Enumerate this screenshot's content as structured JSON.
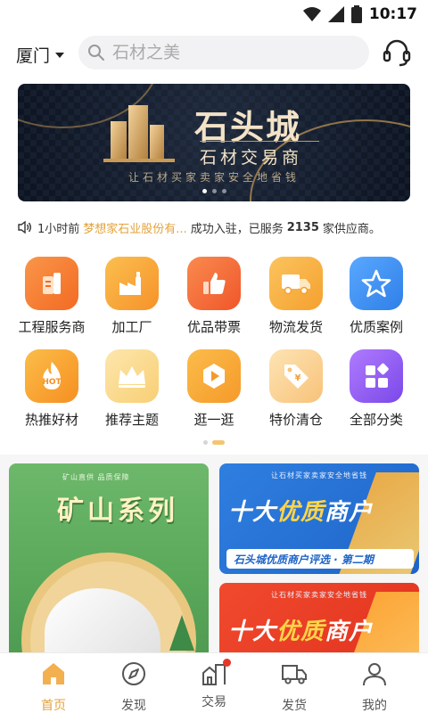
{
  "status": {
    "time": "10:17"
  },
  "topbar": {
    "city": "厦门",
    "search_placeholder": "石材之美"
  },
  "banner": {
    "title": "石头城",
    "subtitle": "石材交易商",
    "slogan": "让石材买家卖家安全地省钱"
  },
  "notice": {
    "time": "1小时前",
    "company": "梦想家石业股份有...",
    "text1": "成功入驻，已服务",
    "count": "2135",
    "text2": "家供应商。"
  },
  "grid": {
    "items": [
      {
        "label": "工程服务商",
        "icon": "building-icon",
        "color": "#f67a2c"
      },
      {
        "label": "加工厂",
        "icon": "factory-icon",
        "color": "#f7a83a"
      },
      {
        "label": "优品带票",
        "icon": "thumbs-up-icon",
        "color": "#f46a2e"
      },
      {
        "label": "物流发货",
        "icon": "truck-icon",
        "color": "#f8b44a"
      },
      {
        "label": "优质案例",
        "icon": "star-icon",
        "color": "#3d8ff0"
      },
      {
        "label": "热推好材",
        "icon": "hot-icon",
        "color": "#f6a531",
        "badge": "HOT"
      },
      {
        "label": "推荐主题",
        "icon": "crown-icon",
        "color": "#f7cf76"
      },
      {
        "label": "逛一逛",
        "icon": "play-icon",
        "color": "#f6a03a"
      },
      {
        "label": "特价清仓",
        "icon": "price-tag-icon",
        "color": "#f8c67a"
      },
      {
        "label": "全部分类",
        "icon": "categories-icon",
        "color": "#8d5ef0"
      }
    ]
  },
  "cards": {
    "left": {
      "small": "矿山直供 品质保障",
      "title": "矿山系列"
    },
    "right1": {
      "top": "让石材买家卖家安全地省钱",
      "title_a": "十大",
      "title_b": "优质",
      "title_c": "商户",
      "pill": "石头城优质商户评选 · 第二期"
    },
    "right2": {
      "top": "让石材买家卖家安全地省钱",
      "title_a": "十大",
      "title_b": "优质",
      "title_c": "商户"
    }
  },
  "tabbar": {
    "tabs": [
      {
        "label": "首页",
        "icon": "home-icon",
        "active": true
      },
      {
        "label": "发现",
        "icon": "compass-icon"
      },
      {
        "label": "交易",
        "icon": "trade-icon",
        "badge": true
      },
      {
        "label": "发货",
        "icon": "truck-icon"
      },
      {
        "label": "我的",
        "icon": "profile-icon"
      }
    ]
  },
  "colors": {
    "accent": "#e3a23b",
    "banner_gold": "#f3e3c7"
  }
}
